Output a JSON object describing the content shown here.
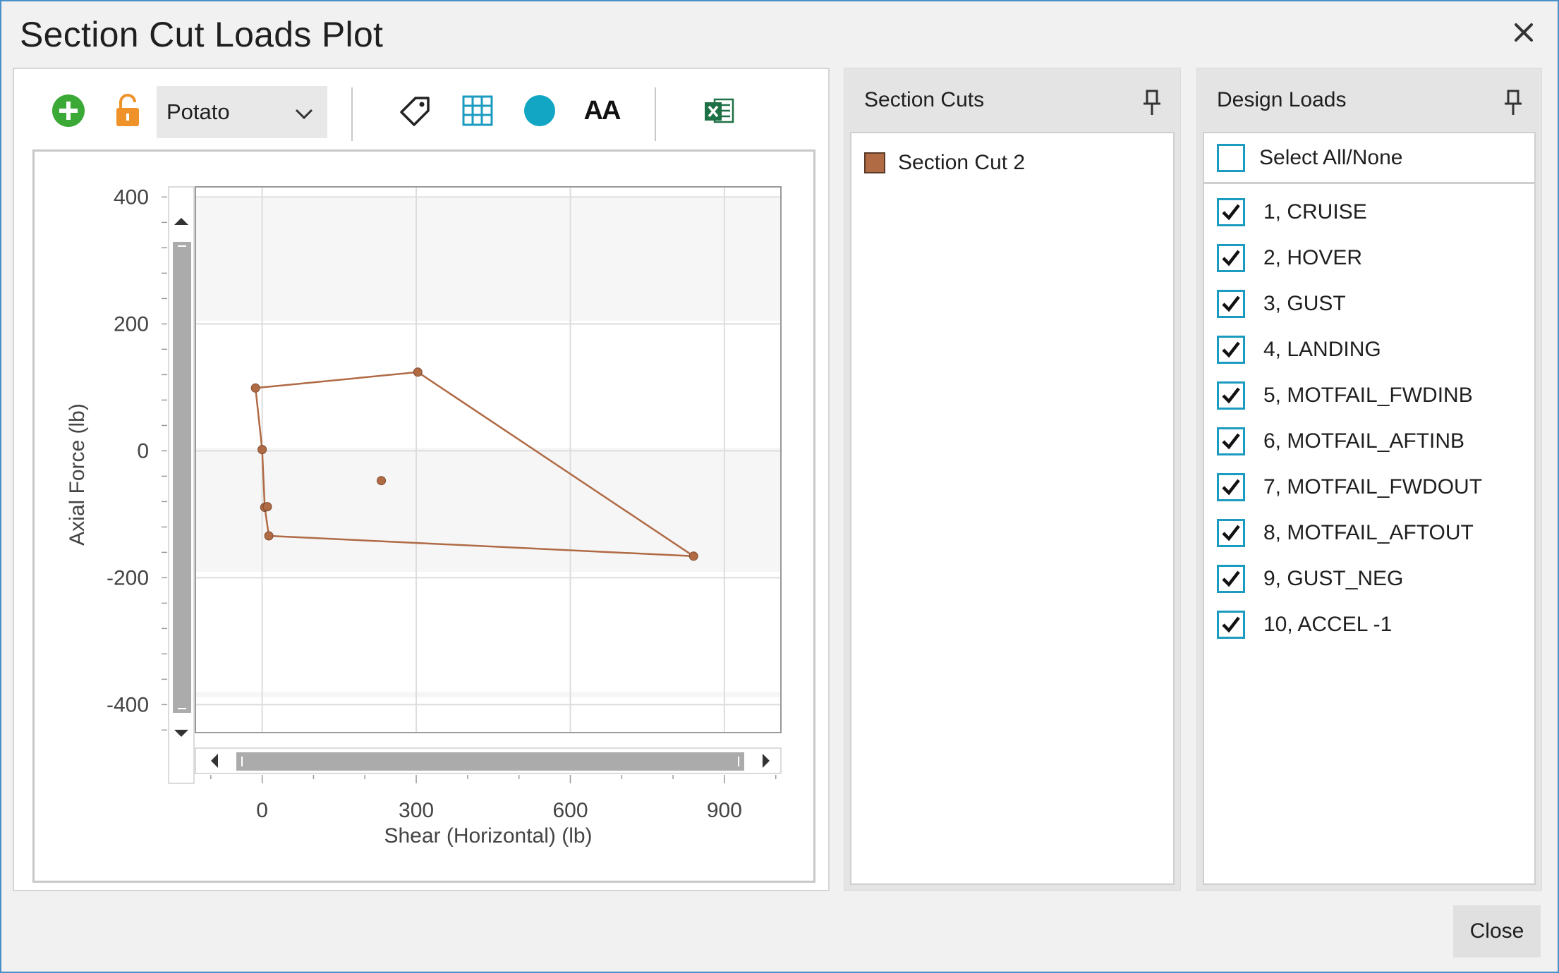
{
  "window": {
    "title": "Section Cut Loads Plot"
  },
  "toolbar": {
    "dropdown_value": "Potato",
    "text_size_glyph": "AA"
  },
  "section_cuts": {
    "header": "Section Cuts",
    "items": [
      {
        "label": "Section Cut 2",
        "color": "#b06a44"
      }
    ]
  },
  "design_loads": {
    "header": "Design Loads",
    "select_all_label": "Select All/None",
    "items": [
      {
        "label": "1, CRUISE",
        "checked": true
      },
      {
        "label": "2, HOVER",
        "checked": true
      },
      {
        "label": "3, GUST",
        "checked": true
      },
      {
        "label": "4, LANDING",
        "checked": true
      },
      {
        "label": "5, MOTFAIL_FWDINB",
        "checked": true
      },
      {
        "label": "6, MOTFAIL_AFTINB",
        "checked": true
      },
      {
        "label": "7, MOTFAIL_FWDOUT",
        "checked": true
      },
      {
        "label": "8, MOTFAIL_AFTOUT",
        "checked": true
      },
      {
        "label": "9, GUST_NEG",
        "checked": true
      },
      {
        "label": "10, ACCEL -1",
        "checked": true
      }
    ]
  },
  "footer": {
    "close_label": "Close"
  },
  "colors": {
    "series": "#b06a44",
    "accent": "#1a9bbf",
    "add_icon": "#3aa935",
    "lock_icon": "#f0922a",
    "excel_icon": "#1e7145"
  },
  "chart_data": {
    "type": "scatter",
    "xlabel": "Shear (Horizontal) (lb)",
    "ylabel": "Axial Force (lb)",
    "xlim": [
      -130,
      1010
    ],
    "ylim": [
      -444,
      416
    ],
    "x_ticks": [
      0,
      300,
      600,
      900
    ],
    "y_ticks": [
      400,
      200,
      0,
      -200,
      -400
    ],
    "grid": true,
    "series": [
      {
        "points": [
          {
            "x": -13,
            "y": 99
          },
          {
            "x": 303,
            "y": 124
          },
          {
            "x": 840,
            "y": -166
          },
          {
            "x": 13,
            "y": -134
          },
          {
            "x": 5,
            "y": -89
          },
          {
            "x": 10,
            "y": -88
          },
          {
            "x": 0,
            "y": 2
          },
          {
            "x": 232,
            "y": -47
          }
        ],
        "envelope": [
          {
            "x": -13,
            "y": 99
          },
          {
            "x": 303,
            "y": 124
          },
          {
            "x": 840,
            "y": -166
          },
          {
            "x": 13,
            "y": -134
          },
          {
            "x": 5,
            "y": -89
          },
          {
            "x": 0,
            "y": 2
          },
          {
            "x": -13,
            "y": 99
          }
        ]
      }
    ]
  }
}
